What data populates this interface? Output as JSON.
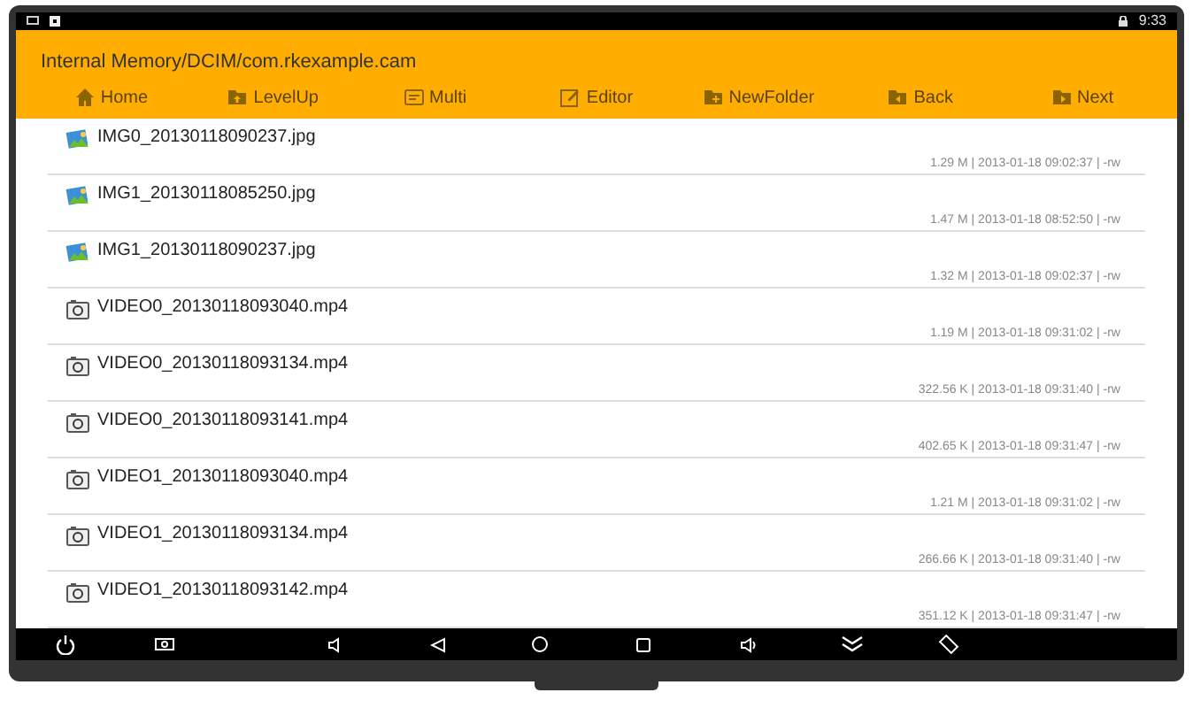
{
  "status_bar": {
    "time": "9:33"
  },
  "path": "Internal Memory/DCIM/com.rkexample.cam",
  "toolbar": [
    {
      "label": "Home",
      "kind": "home"
    },
    {
      "label": "LevelUp",
      "kind": "levelup"
    },
    {
      "label": "Multi",
      "kind": "multi"
    },
    {
      "label": "Editor",
      "kind": "editor"
    },
    {
      "label": "NewFolder",
      "kind": "newfolder"
    },
    {
      "label": "Back",
      "kind": "back"
    },
    {
      "label": "Next",
      "kind": "next"
    }
  ],
  "files": [
    {
      "name": "IMG0_20130118090237.jpg",
      "info": "1.29 M | 2013-01-18 09:02:37 | -rw",
      "kind": "image"
    },
    {
      "name": "IMG1_20130118085250.jpg",
      "info": "1.47 M | 2013-01-18 08:52:50 | -rw",
      "kind": "image"
    },
    {
      "name": "IMG1_20130118090237.jpg",
      "info": "1.32 M | 2013-01-18 09:02:37 | -rw",
      "kind": "image"
    },
    {
      "name": "VIDEO0_20130118093040.mp4",
      "info": "1.19 M | 2013-01-18 09:31:02 | -rw",
      "kind": "video"
    },
    {
      "name": "VIDEO0_20130118093134.mp4",
      "info": "322.56 K | 2013-01-18 09:31:40 | -rw",
      "kind": "video"
    },
    {
      "name": "VIDEO0_20130118093141.mp4",
      "info": "402.65 K | 2013-01-18 09:31:47 | -rw",
      "kind": "video"
    },
    {
      "name": "VIDEO1_20130118093040.mp4",
      "info": "1.21 M | 2013-01-18 09:31:02 | -rw",
      "kind": "video"
    },
    {
      "name": "VIDEO1_20130118093134.mp4",
      "info": "266.66 K | 2013-01-18 09:31:40 | -rw",
      "kind": "video"
    },
    {
      "name": "VIDEO1_20130118093142.mp4",
      "info": "351.12 K | 2013-01-18 09:31:47 | -rw",
      "kind": "video"
    }
  ]
}
